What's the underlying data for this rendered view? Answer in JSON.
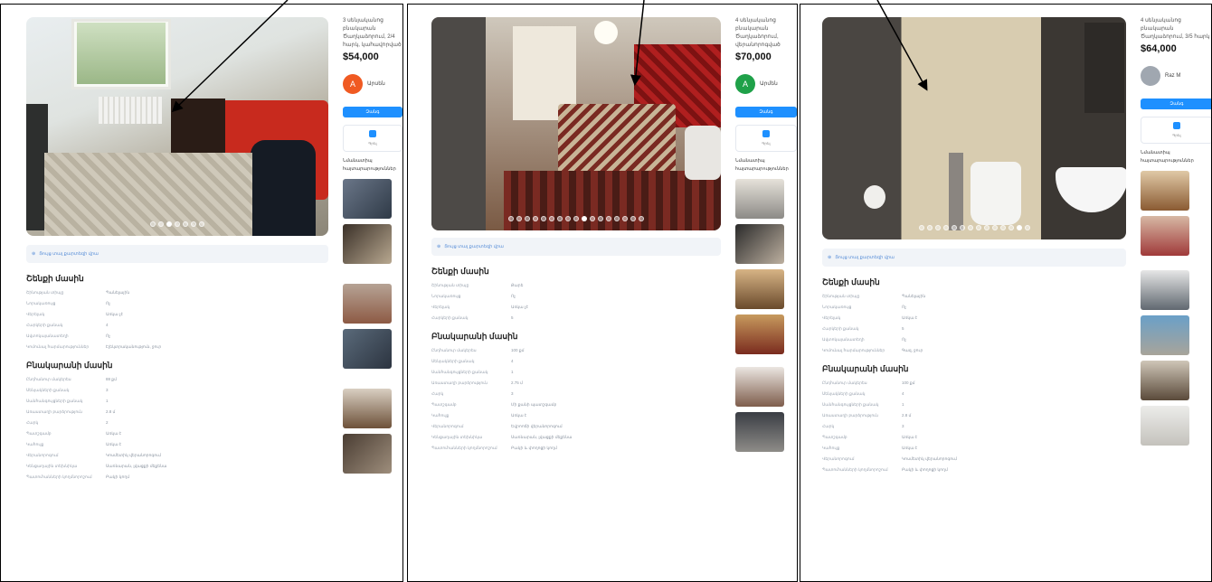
{
  "colors": {
    "accent": "#1e90ff",
    "panel_border": "#000000",
    "muted": "#9aa3af"
  },
  "listings": [
    {
      "description": "3 սենյականոց բնակարան Ծաղկաձորում, 2/4 հարկ, կահավորված",
      "price": "$54,000",
      "agent_initial": "A",
      "agent_name": "Արսեն",
      "agent_color": "#f05a22",
      "call_label": "Զանգ",
      "icon_label": "Գրել",
      "similar_label": "Նմանատիպ հայտարարություններ",
      "map_label": "Ցույց տալ քարտեզի վրա",
      "building_title": "Շենքի մասին",
      "building_rows": [
        [
          "Շինության տիպը",
          "Պանելային"
        ],
        [
          "Նորակառույց",
          "Ոչ"
        ],
        [
          "Վերելակ",
          "Առկա չէ"
        ],
        [
          "Հարկերի քանակ",
          "4"
        ],
        [
          "Ավտոկայանատեղի",
          "Ոչ"
        ],
        [
          "Կոմունալ հարմարություններ",
          "Էլեկտրականություն, ջուր"
        ]
      ],
      "apartment_title": "Բնակարանի մասին",
      "apartment_rows": [
        [
          "Ընդհանուր մակերես",
          "88 քմ"
        ],
        [
          "Սենյակների քանակ",
          "3"
        ],
        [
          "Սանհանգույցների քանակ",
          "1"
        ],
        [
          "Առաստաղի բարձրություն",
          "2.8 մ"
        ],
        [
          "Հարկ",
          "2"
        ],
        [
          "Պատշգամբ",
          "Առկա է"
        ],
        [
          "Կահույք",
          "Առկա է"
        ],
        [
          "Վերանորոգում",
          "Կոսմետիկ վերանորոգում"
        ],
        [
          "Կենցաղային տեխնիկա",
          "Սառնարան, լվացքի մեքենա"
        ],
        [
          "Պատուհանների կողմնորոշում",
          "Բակի կողմ"
        ]
      ],
      "dots_total": 7,
      "dots_active": 2
    },
    {
      "description": "4 սենյականոց բնակարան Ծաղկաձորում, վերանորոգված",
      "price": "$70,000",
      "agent_initial": "A",
      "agent_name": "Արմեն",
      "agent_color": "#1fa149",
      "call_label": "Զանգ",
      "icon_label": "Գրել",
      "similar_label": "Նմանատիպ հայտարարություններ",
      "map_label": "Ցույց տալ քարտեզի վրա",
      "building_title": "Շենքի մասին",
      "building_rows": [
        [
          "Շինության տիպը",
          "Քարե"
        ],
        [
          "Նորակառույց",
          "Ոչ"
        ],
        [
          "Վերելակ",
          "Առկա չէ"
        ],
        [
          "Հարկերի քանակ",
          "5"
        ]
      ],
      "apartment_title": "Բնակարանի մասին",
      "apartment_rows": [
        [
          "Ընդհանուր մակերես",
          "100 քմ"
        ],
        [
          "Սենյակների քանակ",
          "4"
        ],
        [
          "Սանհանգույցների քանակ",
          "1"
        ],
        [
          "Առաստաղի բարձրություն",
          "2.75 մ"
        ],
        [
          "Հարկ",
          "3"
        ],
        [
          "Պատշգամբ",
          "Մի քանի պատշգամբ"
        ],
        [
          "Կահույք",
          "Առկա է"
        ],
        [
          "Վերանորոգում",
          "Եվրոոճի վերանորոգում"
        ],
        [
          "Կենցաղային տեխնիկա",
          "Սառնարան, լվացքի մեքենա"
        ],
        [
          "Պատուհանների կողմնորոշում",
          "Բակի և փողոցի կողմ"
        ]
      ],
      "dots_total": 17,
      "dots_active": 9
    },
    {
      "description": "4 սենյականոց բնակարան Ծաղկաձորում, 3/5 հարկ",
      "price": "$64,000",
      "agent_initial": "",
      "agent_name": "Raz M",
      "agent_color": "#a0a7b0",
      "call_label": "Զանգ",
      "icon_label": "Գրել",
      "similar_label": "Նմանատիպ հայտարարություններ",
      "map_label": "Ցույց տալ քարտեզի վրա",
      "building_title": "Շենքի մասին",
      "building_rows": [
        [
          "Շինության տիպը",
          "Պանելային"
        ],
        [
          "Նորակառույց",
          "Ոչ"
        ],
        [
          "Վերելակ",
          "Առկա է"
        ],
        [
          "Հարկերի քանակ",
          "5"
        ],
        [
          "Ավտոկայանատեղի",
          "Ոչ"
        ],
        [
          "Կոմունալ հարմարություններ",
          "Գազ, ջուր"
        ]
      ],
      "apartment_title": "Բնակարանի մասին",
      "apartment_rows": [
        [
          "Ընդհանուր մակերես",
          "100 քմ"
        ],
        [
          "Սենյակների քանակ",
          "4"
        ],
        [
          "Սանհանգույցների քանակ",
          "1"
        ],
        [
          "Առաստաղի բարձրություն",
          "2.8 մ"
        ],
        [
          "Հարկ",
          "3"
        ],
        [
          "Պատշգամբ",
          "Առկա է"
        ],
        [
          "Կահույք",
          "Առկա է"
        ],
        [
          "Վերանորոգում",
          "Կոսմետիկ վերանորոգում"
        ],
        [
          "Պատուհանների կողմնորոշում",
          "Բակի և փողոցի կողմ"
        ]
      ],
      "dots_total": 14,
      "dots_active": 12
    }
  ]
}
